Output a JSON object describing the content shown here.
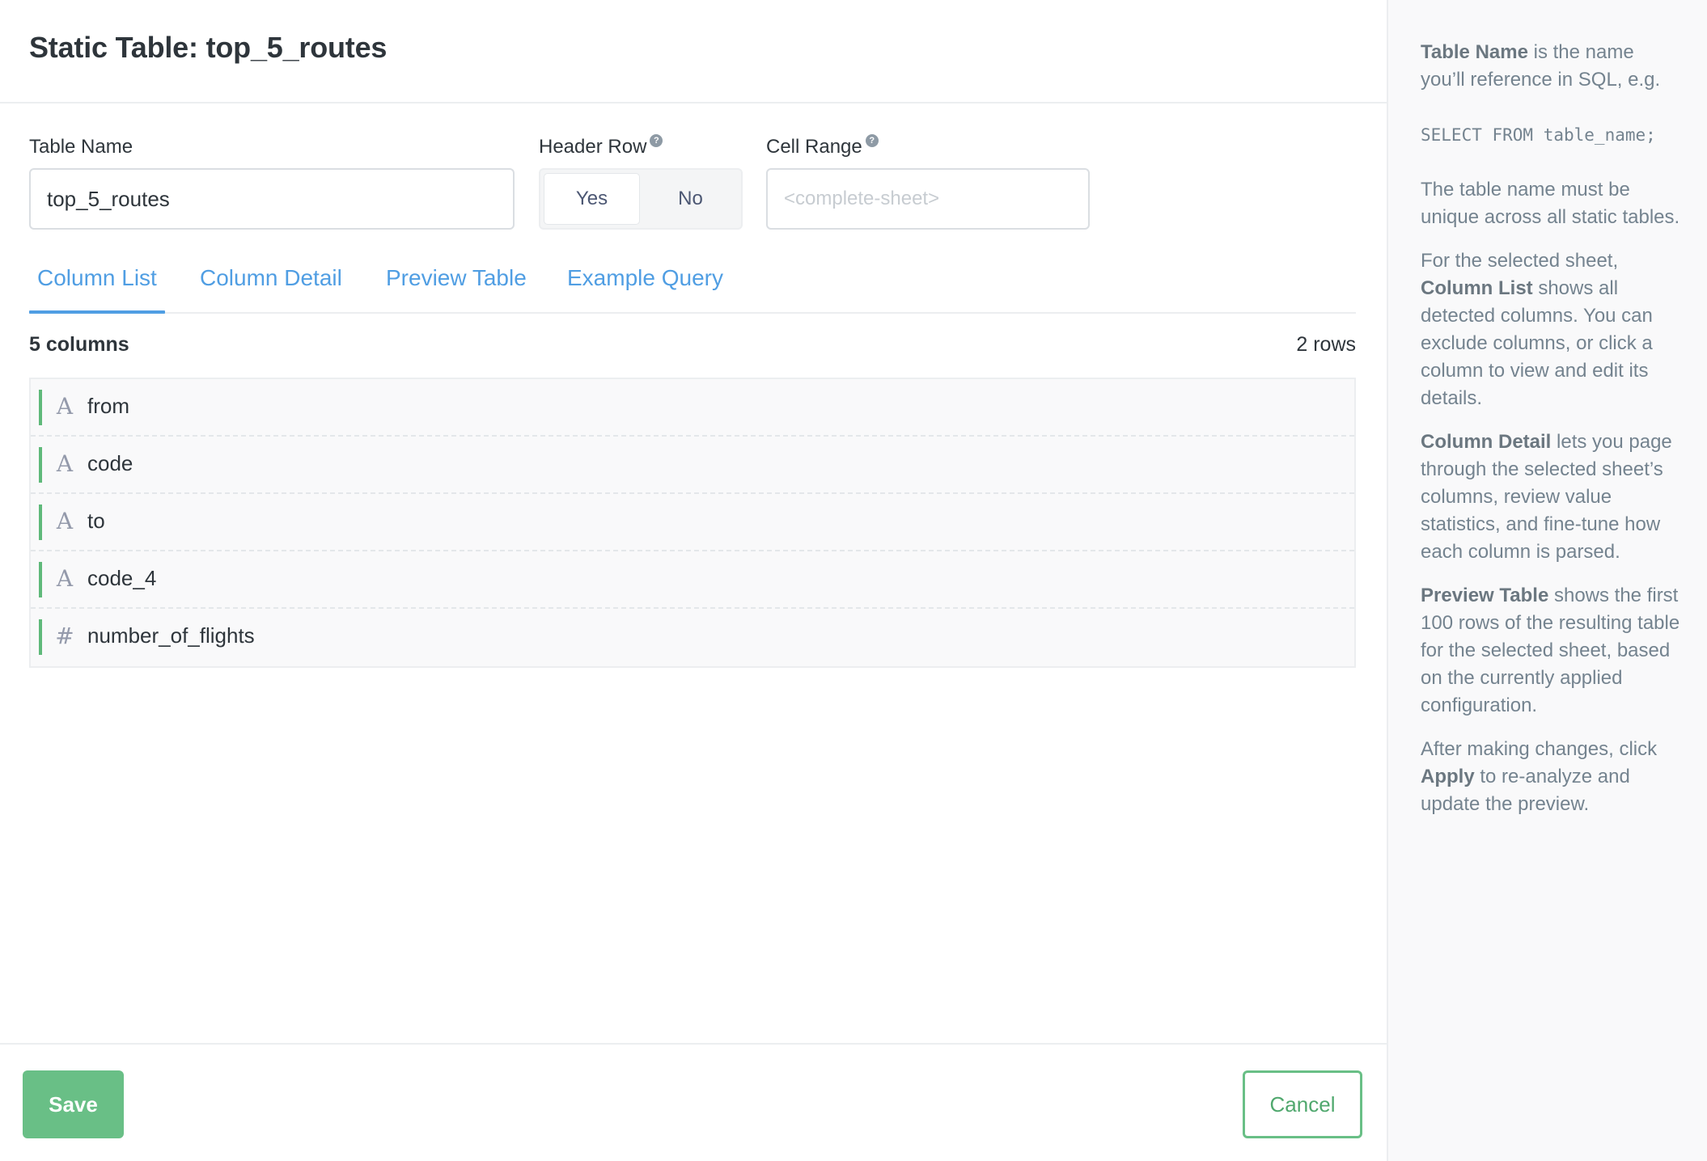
{
  "header": {
    "title": "Static Table: top_5_routes"
  },
  "form": {
    "table_name_label": "Table Name",
    "table_name_value": "top_5_routes",
    "header_row_label": "Header Row",
    "header_row_options": [
      "Yes",
      "No"
    ],
    "header_row_selected": "Yes",
    "cell_range_label": "Cell Range",
    "cell_range_placeholder": "<complete-sheet>",
    "help_glyph": "?"
  },
  "tabs": [
    {
      "label": "Column List",
      "active": true
    },
    {
      "label": "Column Detail",
      "active": false
    },
    {
      "label": "Preview Table",
      "active": false
    },
    {
      "label": "Example Query",
      "active": false
    }
  ],
  "summary": {
    "columns": "5 columns",
    "rows": "2 rows"
  },
  "columns": [
    {
      "name": "from",
      "type_icon": "text-type-icon",
      "glyph": "A"
    },
    {
      "name": "code",
      "type_icon": "text-type-icon",
      "glyph": "A"
    },
    {
      "name": "to",
      "type_icon": "text-type-icon",
      "glyph": "A"
    },
    {
      "name": "code_4",
      "type_icon": "text-type-icon",
      "glyph": "A"
    },
    {
      "name": "number_of_flights",
      "type_icon": "number-type-icon",
      "glyph": "#"
    }
  ],
  "footer": {
    "save_label": "Save",
    "cancel_label": "Cancel"
  },
  "sidebar": {
    "p1_bold": "Table Name",
    "p1_rest": " is the name you’ll reference in SQL, e.g.",
    "code": "SELECT FROM table_name;",
    "p2": "The table name must be unique across all static tables.",
    "p3_pre": "For the selected sheet, ",
    "p3_bold": "Column List",
    "p3_rest": " shows all detected columns. You can exclude columns, or click a column to view and edit its details.",
    "p4_bold": "Column Detail",
    "p4_rest": " lets you page through the selected sheet’s columns, review value statistics, and fine-tune how each column is parsed.",
    "p5_bold": "Preview Table",
    "p5_rest": " shows the first 100 rows of the resulting table for the selected sheet, based on the currently applied configuration.",
    "p6_pre": "After making changes, click ",
    "p6_bold": "Apply",
    "p6_rest": " to re-analyze and update the preview."
  },
  "colors": {
    "accent_blue": "#509ee3",
    "accent_green": "#69bf86"
  }
}
